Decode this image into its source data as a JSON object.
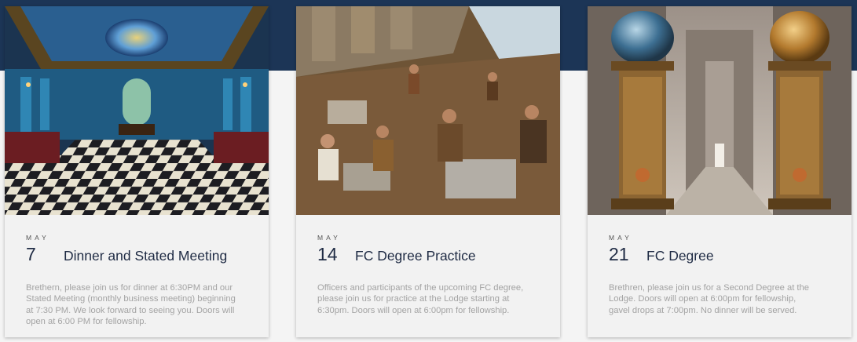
{
  "events": [
    {
      "month": "MAY",
      "day": "7",
      "title": "Dinner and Stated Meeting",
      "description": "Brethern, please join us for dinner at 6:30PM and our Stated Meeting (monthly business meeting) beginning at 7:30 PM.  We look forward to seeing you.  Doors will open at 6:00 PM for fellowship."
    },
    {
      "month": "MAY",
      "day": "14",
      "title": "FC Degree Practice",
      "description": "Officers and participants of the upcoming FC degree, please join us for practice at the Lodge starting at 6:30pm. Doors will open at 6:00pm for fellowship."
    },
    {
      "month": "MAY",
      "day": "21",
      "title": "FC Degree",
      "description": "Brethren, please join us for a Second Degree at the Lodge. Doors will open at 6:00pm for fellowship, gavel drops at 7:00pm. No dinner will be served."
    }
  ],
  "colors": {
    "banner": "#1c3556",
    "title": "#1f2b44",
    "description": "#a3a3a3"
  }
}
